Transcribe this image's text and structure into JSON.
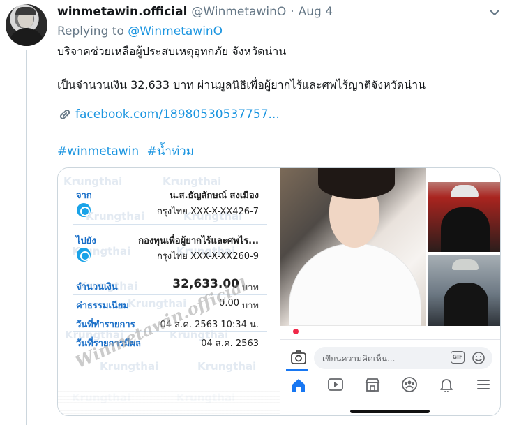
{
  "tweet": {
    "display_name": "winmetawin.official",
    "handle": "@WinmetawinO",
    "separator": "·",
    "date": "Aug 4",
    "replying_prefix": "Replying to",
    "replying_to": "@WinmetawinO",
    "text_line1": "บริจาคช่วยเหลือผู้ประสบเหตุอุทกภัย จังหวัดน่าน",
    "text_line2": "เป็นจำนวนเงิน  32,633 บาท  ผ่านมูลนิธิเพื่อผู้ยากไร้และศพไร้ญาติจังหวัดน่าน",
    "link_text": "facebook.com/18980530537757...",
    "hashtags": [
      "#winmetawin",
      "#น้ำท่วม"
    ]
  },
  "receipt": {
    "watermark": "Krungthai",
    "from_label": "จาก",
    "from_name": "น.ส.ธัญลักษณ์ สงเมือง",
    "from_account": "กรุงไทย XXX-X-XX426-7",
    "to_label": "ไปยัง",
    "to_name": "กองทุนเพื่อผู้ยากไร้และศพไร...",
    "to_account": "กรุงไทย XXX-X-XX260-9",
    "amount_label": "จำนวนเงิน",
    "amount_value": "32,633.00",
    "amount_unit": "บาท",
    "fee_label": "ค่าธรรมเนียม",
    "fee_value": "0.00",
    "fee_unit": "บาท",
    "txn_date_label": "วันที่ทำรายการ",
    "txn_date_value": "04 ส.ค. 2563 10:34 น.",
    "effective_date_label": "วันที่รายการมีผล",
    "effective_date_value": "04 ส.ค. 2563",
    "signature": "Winmetawin.official"
  },
  "facebook_screen": {
    "comment_placeholder": "เขียนความคิดเห็น...",
    "gif_label": "GIF",
    "nav_icons": [
      "home-icon",
      "watch-icon",
      "marketplace-icon",
      "groups-icon",
      "notifications-icon",
      "menu-icon"
    ]
  },
  "colors": {
    "link": "#1b95e0",
    "muted": "#657786",
    "krungthai": "#1aa3e8",
    "facebook": "#1877f2"
  }
}
